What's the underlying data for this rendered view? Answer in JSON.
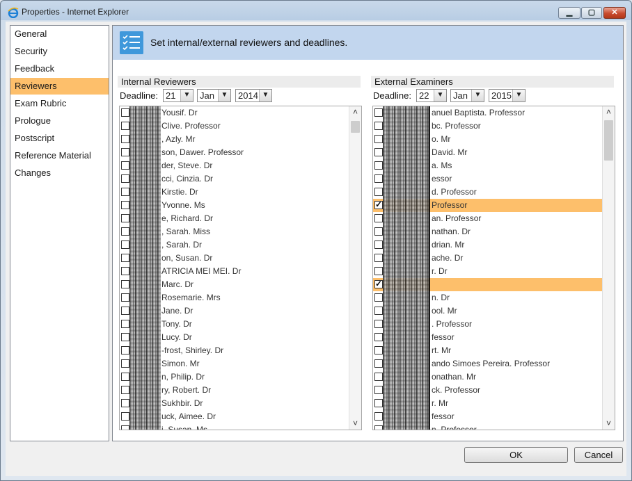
{
  "window": {
    "title": "Properties - Internet Explorer",
    "icon": "ie-icon"
  },
  "nav": [
    {
      "label": "General"
    },
    {
      "label": "Security"
    },
    {
      "label": "Feedback"
    },
    {
      "label": "Reviewers",
      "active": true
    },
    {
      "label": "Exam Rubric"
    },
    {
      "label": "Prologue"
    },
    {
      "label": "Postscript"
    },
    {
      "label": "Reference Material"
    },
    {
      "label": "Changes"
    }
  ],
  "banner": {
    "text": "Set internal/external reviewers and deadlines."
  },
  "internal": {
    "heading": "Internal Reviewers",
    "deadline_label": "Deadline:",
    "day": "21",
    "month": "Jan",
    "year": "2014",
    "rows": [
      {
        "name": "Yousif. Dr",
        "checked": false
      },
      {
        "name": "Clive. Professor",
        "checked": false
      },
      {
        "name": ", Azly. Mr",
        "checked": false
      },
      {
        "name": "son, Dawer. Professor",
        "checked": false
      },
      {
        "name": "der, Steve. Dr",
        "checked": false
      },
      {
        "name": "cci, Cinzia. Dr",
        "checked": false
      },
      {
        "name": "Kirstie. Dr",
        "checked": false
      },
      {
        "name": "Yvonne. Ms",
        "checked": false
      },
      {
        "name": "e, Richard. Dr",
        "checked": false
      },
      {
        "name": ", Sarah. Miss",
        "checked": false
      },
      {
        "name": ", Sarah. Dr",
        "checked": false
      },
      {
        "name": "on, Susan. Dr",
        "checked": false
      },
      {
        "name": "ATRICIA MEI MEI. Dr",
        "checked": false
      },
      {
        "name": "Marc. Dr",
        "checked": false
      },
      {
        "name": "Rosemarie. Mrs",
        "checked": false
      },
      {
        "name": "Jane. Dr",
        "checked": false
      },
      {
        "name": "Tony. Dr",
        "checked": false
      },
      {
        "name": "Lucy. Dr",
        "checked": false
      },
      {
        "name": "-frost, Shirley. Dr",
        "checked": false
      },
      {
        "name": "Simon. Mr",
        "checked": false
      },
      {
        "name": "n, Philip. Dr",
        "checked": false
      },
      {
        "name": "ry, Robert. Dr",
        "checked": false
      },
      {
        "name": "Sukhbir. Dr",
        "checked": false
      },
      {
        "name": "uck, Aimee. Dr",
        "checked": false
      },
      {
        "name": "i, Susan. Ms",
        "checked": false
      }
    ]
  },
  "external": {
    "heading": "External Examiners",
    "deadline_label": "Deadline:",
    "day": "22",
    "month": "Jan",
    "year": "2015",
    "rows": [
      {
        "name": "anuel Baptista. Professor",
        "checked": false
      },
      {
        "name": "bc. Professor",
        "checked": false
      },
      {
        "name": "o. Mr",
        "checked": false
      },
      {
        "name": "David. Mr",
        "checked": false
      },
      {
        "name": "a. Ms",
        "checked": false
      },
      {
        "name": "essor",
        "checked": false
      },
      {
        "name": "d. Professor",
        "checked": false
      },
      {
        "name": "Professor",
        "checked": true
      },
      {
        "name": "an. Professor",
        "checked": false
      },
      {
        "name": "nathan. Dr",
        "checked": false
      },
      {
        "name": "drian. Mr",
        "checked": false
      },
      {
        "name": "ache. Dr",
        "checked": false
      },
      {
        "name": "r. Dr",
        "checked": false
      },
      {
        "name": "",
        "checked": true
      },
      {
        "name": "n. Dr",
        "checked": false
      },
      {
        "name": "ool. Mr",
        "checked": false
      },
      {
        "name": ". Professor",
        "checked": false
      },
      {
        "name": "fessor",
        "checked": false
      },
      {
        "name": "rt. Mr",
        "checked": false
      },
      {
        "name": "ando Simoes Pereira. Professor",
        "checked": false
      },
      {
        "name": "onathan. Mr",
        "checked": false
      },
      {
        "name": "ck. Professor",
        "checked": false
      },
      {
        "name": "r. Mr",
        "checked": false
      },
      {
        "name": "fessor",
        "checked": false
      },
      {
        "name": "n. Professor",
        "checked": false
      }
    ]
  },
  "buttons": {
    "ok": "OK",
    "cancel": "Cancel"
  }
}
